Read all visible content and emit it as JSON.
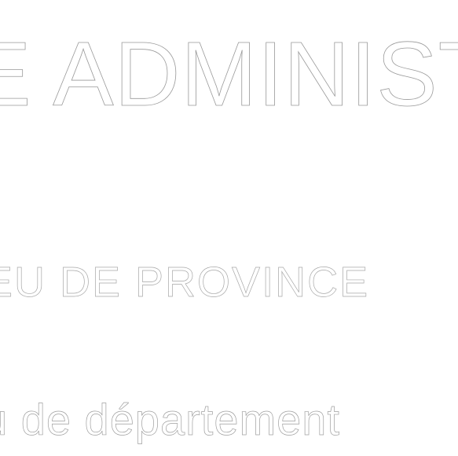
{
  "lines": {
    "heading": "E ADMINIST",
    "subheading": "EU DE PROVINCE",
    "caption": "u de département"
  },
  "colors": {
    "background": "#ffffff",
    "outline": "#9a9a9a"
  }
}
